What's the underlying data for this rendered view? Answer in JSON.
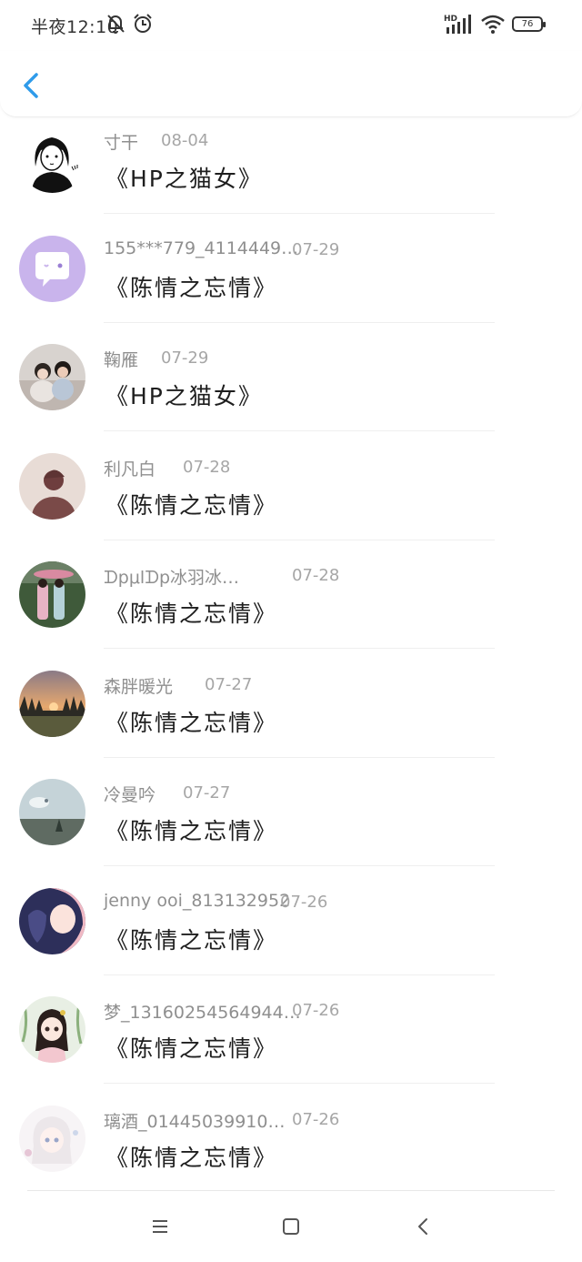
{
  "status_bar": {
    "time": "半夜12:10",
    "battery": "76"
  },
  "header": {
    "back_icon": "chevron-left-icon",
    "accent_color": "#2f9bea"
  },
  "list": {
    "items": [
      {
        "name": "寸干",
        "date": "08-04",
        "title": "《HP之猫女》"
      },
      {
        "name": "155***779_4114449…",
        "date": "07-29",
        "title": "《陈情之忘情》"
      },
      {
        "name": "鞠雁",
        "date": "07-29",
        "title": "《HP之猫女》"
      },
      {
        "name": "利凡白",
        "date": "07-28",
        "title": "《陈情之忘情》"
      },
      {
        "name": "ᗪpμlᗪp冰羽冰…",
        "date": "07-28",
        "title": "《陈情之忘情》"
      },
      {
        "name": "森胖暖光",
        "date": "07-27",
        "title": "《陈情之忘情》"
      },
      {
        "name": "冷曼吟",
        "date": "07-27",
        "title": "《陈情之忘情》"
      },
      {
        "name": "jenny ooi_813132952",
        "date": "07-26",
        "title": "《陈情之忘情》"
      },
      {
        "name": "梦_13160254564944…",
        "date": "07-26",
        "title": "《陈情之忘情》"
      },
      {
        "name": "璃酒_01445039910…",
        "date": "07-26",
        "title": "《陈情之忘情》"
      }
    ]
  },
  "nav_bar": {
    "icons": [
      "menu-icon",
      "home-square-icon",
      "back-triangle-icon"
    ]
  }
}
